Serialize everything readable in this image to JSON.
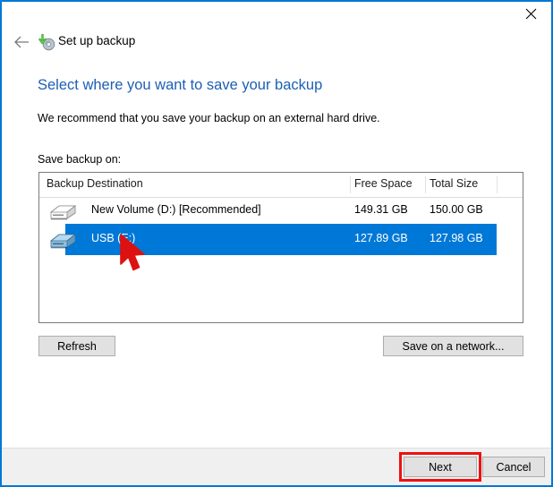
{
  "window": {
    "title": "Set up backup",
    "app_icon": "backup-disk-icon",
    "close_label": "×",
    "back_label": "←",
    "border_color": "#0078d7"
  },
  "content": {
    "heading": "Select where you want to save your backup",
    "heading_color": "#1c5fb4",
    "subtext": "We recommend that you save your backup on an external hard drive.",
    "save_label": "Save backup on:"
  },
  "list": {
    "columns": [
      "Backup Destination",
      "Free Space",
      "Total Size",
      ""
    ],
    "selection_color": "#0078d7",
    "rows": [
      {
        "icon": "hard-drive-icon",
        "name": "New Volume (D:) [Recommended]",
        "free_space": "149.31 GB",
        "total_size": "150.00 GB",
        "selected": false
      },
      {
        "icon": "usb-drive-icon",
        "name": "USB (E:)",
        "free_space": "127.89 GB",
        "total_size": "127.98 GB",
        "selected": true
      }
    ]
  },
  "buttons": {
    "refresh": "Refresh",
    "save_on_network": "Save on a network...",
    "next": "Next",
    "cancel": "Cancel"
  },
  "annotation": {
    "highlight_color": "#ee1111",
    "highlight_target": "next",
    "cursor_color": "#dd1111"
  }
}
